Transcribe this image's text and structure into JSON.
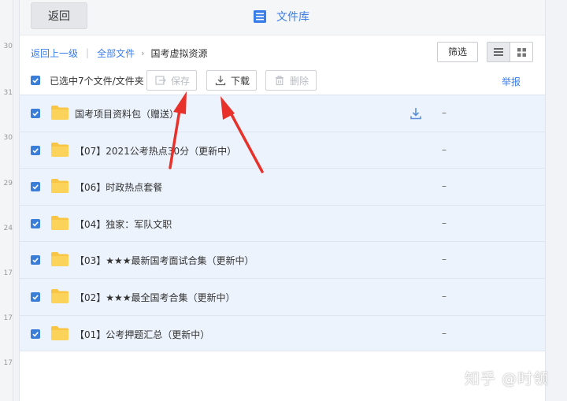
{
  "sidebar_numbers": [
    "30",
    "31",
    "30",
    "29",
    "24",
    "17",
    "17",
    "17"
  ],
  "header": {
    "back_label": "返回",
    "title": "文件库",
    "title_icon": "document-list-icon"
  },
  "breadcrumb": {
    "up_label": "返回上一级",
    "all_label": "全部文件",
    "current": "国考虚拟资源"
  },
  "filter_label": "筛选",
  "toolbar": {
    "selected_label": "已选中7个文件/文件夹",
    "save_label": "保存",
    "download_label": "下载",
    "delete_label": "删除",
    "report_label": "举报"
  },
  "files": [
    {
      "name": "国考项目资料包（赠送）",
      "size": "–",
      "checked": true
    },
    {
      "name": "【07】2021公考热点30分（更新中）",
      "size": "–",
      "checked": true
    },
    {
      "name": "【06】时政热点套餐",
      "size": "–",
      "checked": true
    },
    {
      "name": "【04】独家：军队文职",
      "size": "–",
      "checked": true
    },
    {
      "name": "【03】★★★最新国考面试合集（更新中）",
      "size": "–",
      "checked": true
    },
    {
      "name": "【02】★★★最全国考合集（更新中）",
      "size": "–",
      "checked": true
    },
    {
      "name": "【01】公考押题汇总（更新中）",
      "size": "–",
      "checked": true
    }
  ],
  "watermark": "知乎 @时领",
  "colors": {
    "accent": "#3b7de9",
    "checkbox": "#3a7ed8",
    "row_selected": "#ecf3fc",
    "folder": "#f8c545",
    "arrow": "#e8312a"
  }
}
